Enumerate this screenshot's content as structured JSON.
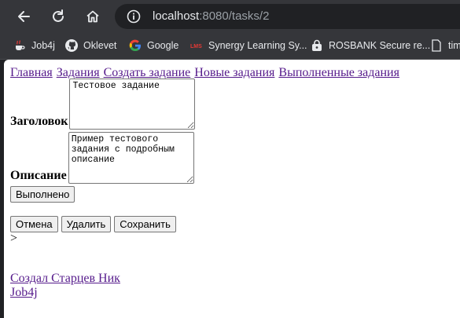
{
  "browser": {
    "url_host": "localhost",
    "url_rest": ":8080/tasks/2",
    "bookmarks": [
      {
        "label": "Job4j",
        "icon": "java-cup-icon"
      },
      {
        "label": "Oklevet",
        "icon": "github-icon"
      },
      {
        "label": "Google",
        "icon": "google-icon"
      },
      {
        "label": "Synergy Learning Sy...",
        "icon": "synergy-icon"
      },
      {
        "label": "ROSBANK Secure re...",
        "icon": "lock-bag-icon"
      },
      {
        "label": "tim",
        "icon": "document-icon"
      }
    ]
  },
  "page": {
    "nav": [
      "Главная",
      "Задания",
      "Создать задание",
      "Новые задания",
      "Выполненные задания"
    ],
    "title_label": "Заголовок",
    "title_value": "Тестовое задание",
    "desc_label": "Описание",
    "desc_value": "Пример тестового задания с подробным описание",
    "done_button": "Выполнено",
    "cancel_button": "Отмена",
    "delete_button": "Удалить",
    "save_button": "Сохранить",
    "stray_text": ">",
    "footer_author": "Создал Старцев Ник",
    "footer_link": "Job4j"
  }
}
